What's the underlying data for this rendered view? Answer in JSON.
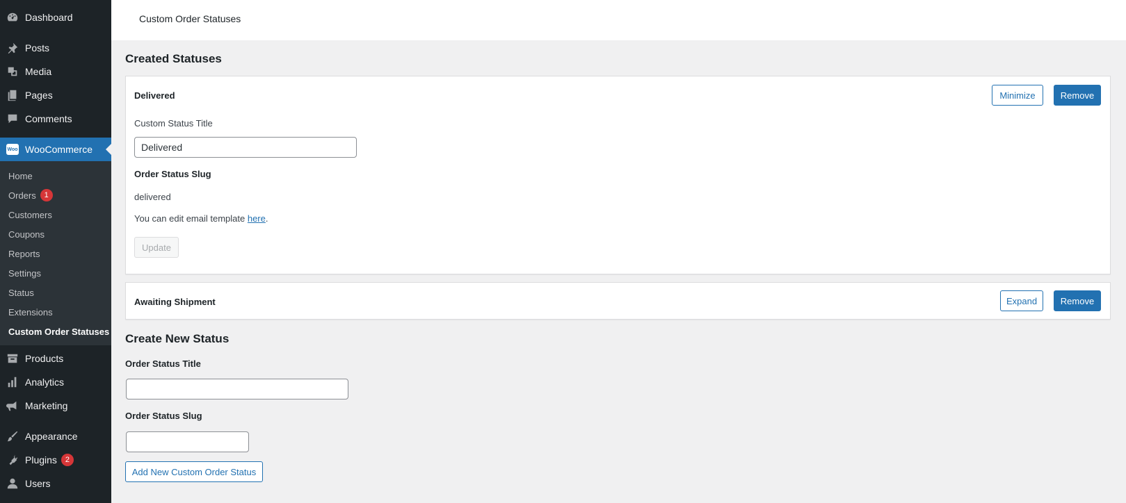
{
  "sidebar": {
    "top_items": [
      {
        "label": "Dashboard",
        "icon": "dashboard-icon"
      },
      {
        "label": "Posts",
        "icon": "pin-icon"
      },
      {
        "label": "Media",
        "icon": "media-icon"
      },
      {
        "label": "Pages",
        "icon": "pages-icon"
      },
      {
        "label": "Comments",
        "icon": "comment-icon"
      }
    ],
    "woocommerce": {
      "label": "WooCommerce",
      "logo_text": "Woo"
    },
    "sub_items": [
      {
        "label": "Home"
      },
      {
        "label": "Orders",
        "badge": "1"
      },
      {
        "label": "Customers"
      },
      {
        "label": "Coupons"
      },
      {
        "label": "Reports"
      },
      {
        "label": "Settings"
      },
      {
        "label": "Status"
      },
      {
        "label": "Extensions"
      },
      {
        "label": "Custom Order Statuses"
      }
    ],
    "bottom_items": [
      {
        "label": "Products",
        "icon": "archive-icon"
      },
      {
        "label": "Analytics",
        "icon": "bar-chart-icon"
      },
      {
        "label": "Marketing",
        "icon": "megaphone-icon"
      },
      {
        "label": "Appearance",
        "icon": "brush-icon"
      },
      {
        "label": "Plugins",
        "icon": "plug-icon",
        "badge": "2"
      },
      {
        "label": "Users",
        "icon": "user-icon"
      }
    ]
  },
  "header": {
    "title": "Custom Order Statuses"
  },
  "created": {
    "heading": "Created Statuses",
    "status1": {
      "name": "Delivered",
      "minimize_label": "Minimize",
      "remove_label": "Remove",
      "title_label": "Custom Status Title",
      "title_value": "Delivered",
      "slug_label": "Order Status Slug",
      "slug_value": "delivered",
      "email_text": "You can edit email template ",
      "email_link": "here",
      "email_suffix": ".",
      "update_label": "Update"
    },
    "status2": {
      "name": "Awaiting Shipment",
      "expand_label": "Expand",
      "remove_label": "Remove"
    }
  },
  "create_new": {
    "heading": "Create New Status",
    "title_label": "Order Status Title",
    "title_value": "",
    "slug_label": "Order Status Slug",
    "slug_value": "",
    "add_label": "Add New Custom Order Status"
  },
  "colors": {
    "accent": "#2271b1",
    "sidebar_bg": "#1d2327",
    "badge": "#d63638"
  }
}
